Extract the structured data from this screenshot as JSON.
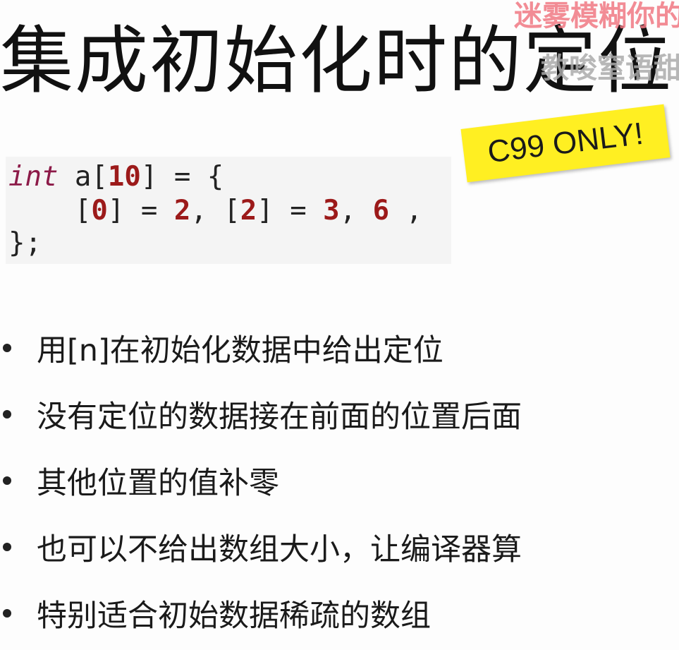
{
  "title": "集成初始化时的定位",
  "watermark": {
    "line1": "迷雾模糊你的",
    "line2": "教唆窒语甜"
  },
  "sticky_note": {
    "text": "C99 ONLY!",
    "color": "#ffef22"
  },
  "code": {
    "line1": {
      "kw": "int",
      "p1": " a[",
      "n1": "10",
      "p2": "] = {"
    },
    "line2": {
      "p1": "    [",
      "n1": "0",
      "p2": "] = ",
      "n2": "2",
      "p3": ", [",
      "n3": "2",
      "p4": "] = ",
      "n4": "3",
      "p5": ", ",
      "n5": "6",
      "p6": " ,"
    },
    "line3": "};"
  },
  "bullets": [
    "用[n]在初始化数据中给出定位",
    "没有定位的数据接在前面的位置后面",
    "其他位置的值补零",
    "也可以不给出数组大小，让编译器算",
    "特别适合初始数据稀疏的数组"
  ]
}
